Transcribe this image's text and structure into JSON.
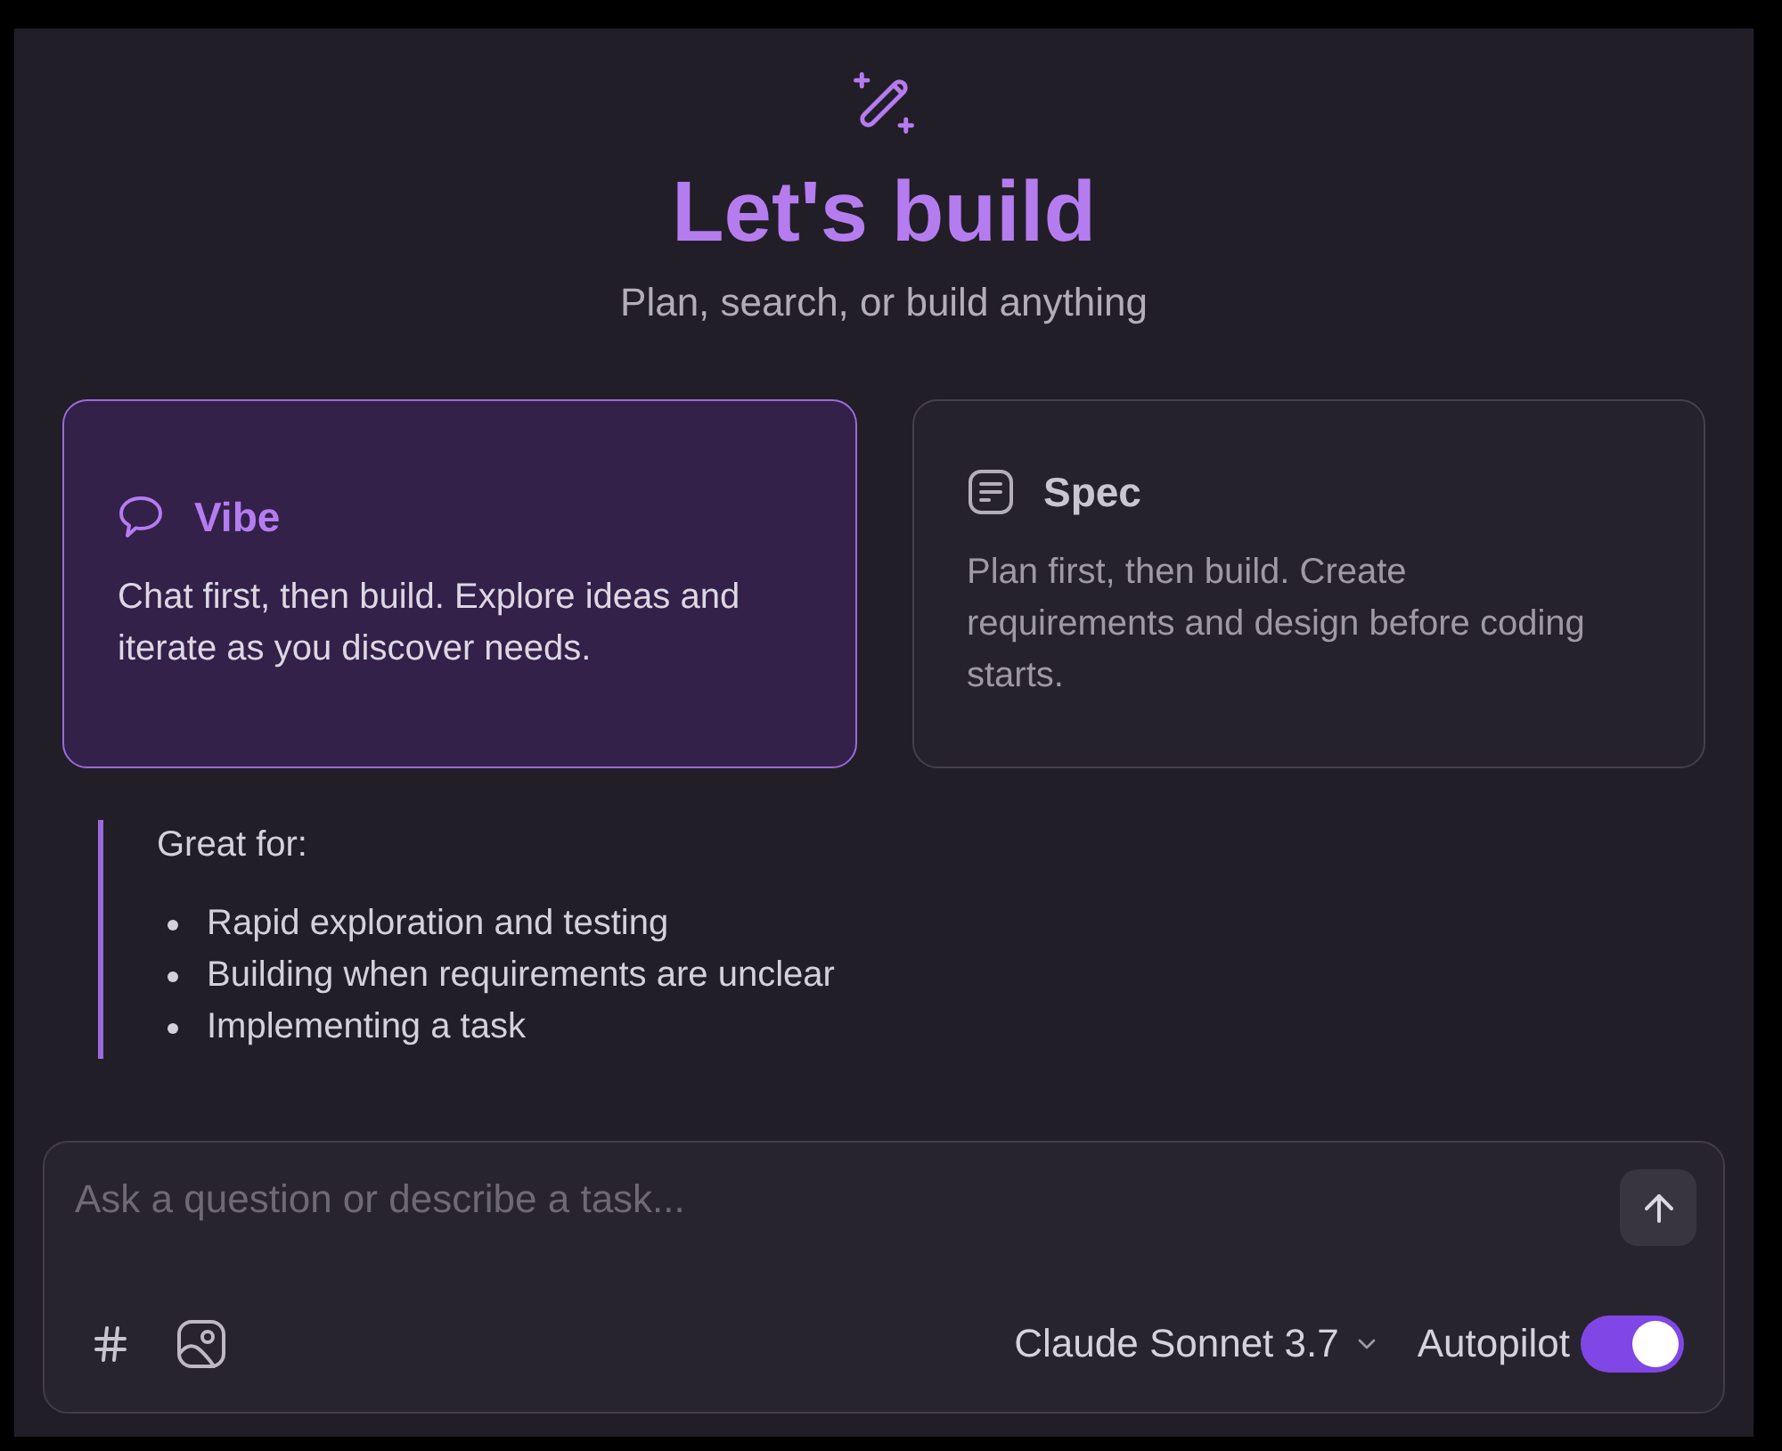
{
  "header": {
    "title": "Let's build",
    "subtitle": "Plan, search, or build anything"
  },
  "modes": [
    {
      "kind": "chat",
      "title": "Vibe",
      "description": "Chat first, then build. Explore ideas and iterate as you discover needs.",
      "selected": true
    },
    {
      "kind": "document",
      "title": "Spec",
      "description": "Plan first, then build. Create requirements and design before coding starts.",
      "selected": false
    }
  ],
  "great_for": {
    "heading": "Great for:",
    "items": [
      "Rapid exploration and testing",
      "Building when requirements are unclear",
      "Implementing a task"
    ]
  },
  "composer": {
    "placeholder": "Ask a question or describe a task...",
    "model": "Claude Sonnet 3.7",
    "autopilot": {
      "label": "Autopilot",
      "on": true
    }
  }
}
